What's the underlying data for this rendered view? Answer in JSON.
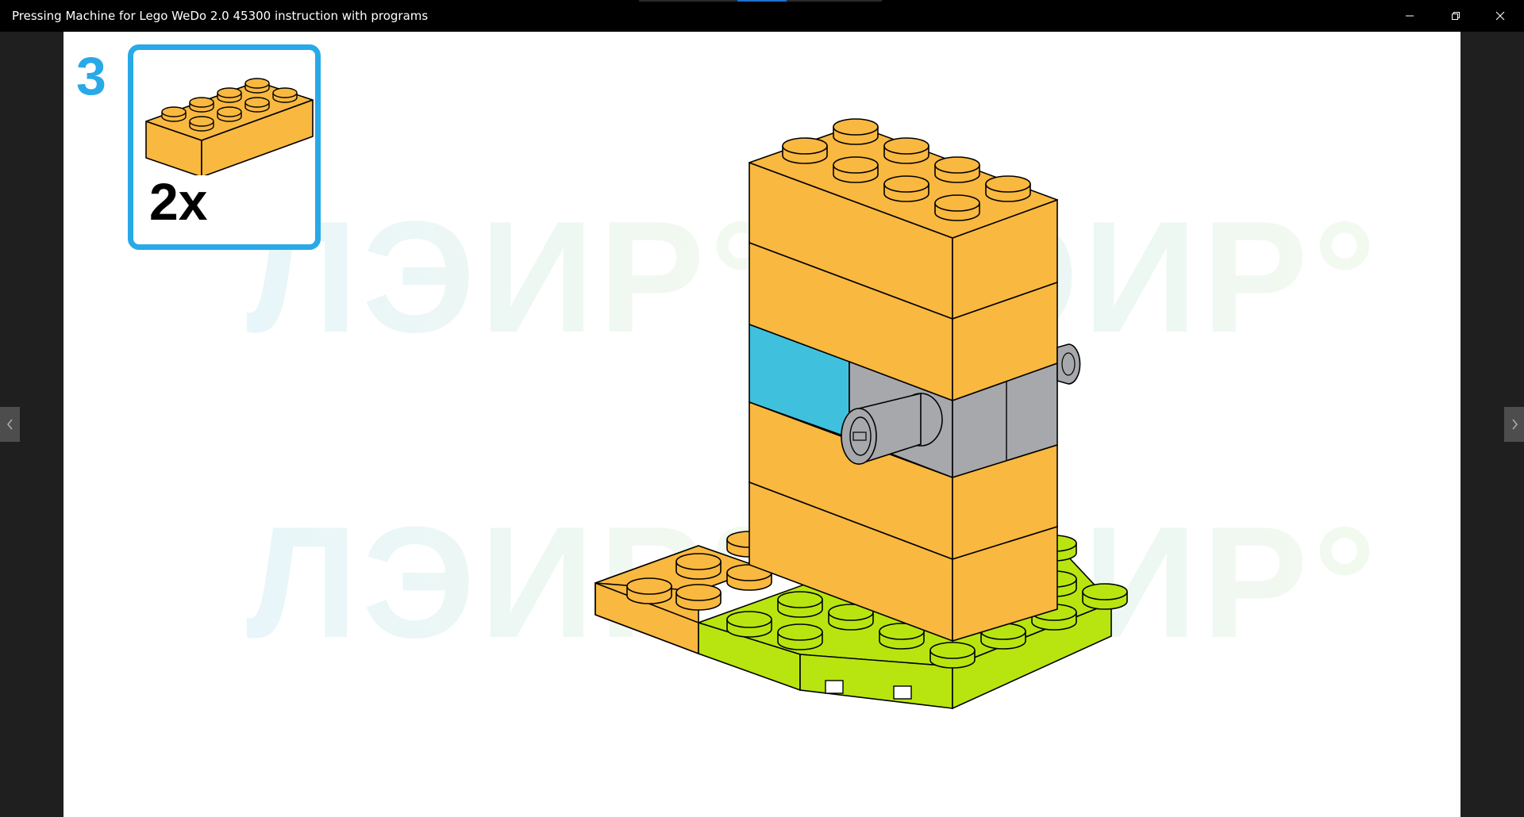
{
  "window": {
    "title": "Pressing Machine for Lego WeDo 2.0 45300 instruction with programs",
    "controls": {
      "minimize_icon": "minimize-icon",
      "restore_icon": "restore-icon",
      "close_icon": "close-icon"
    }
  },
  "navigation": {
    "prev_icon": "chevron-left-icon",
    "next_icon": "chevron-right-icon"
  },
  "instruction": {
    "step_number": "3",
    "parts": [
      {
        "part": "2x4 brick",
        "color": "#f9b83f",
        "quantity": "2x"
      }
    ],
    "watermark_text": "ЛЭИР°"
  },
  "colors": {
    "accent": "#29a9e8",
    "brick_orange": "#f9b83f",
    "plate_lime": "#b8e510",
    "brick_azure": "#3fc1de",
    "technic_gray": "#a6a8ab"
  }
}
